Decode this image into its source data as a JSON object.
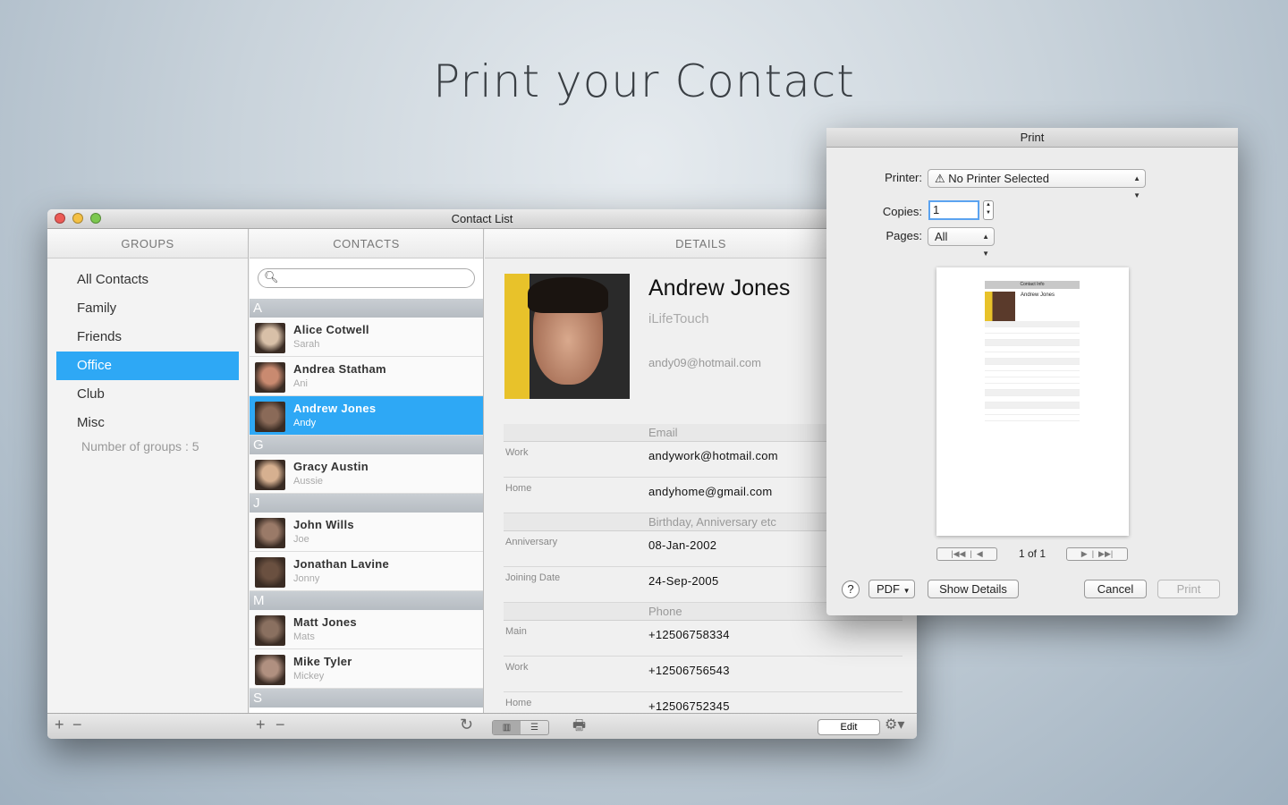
{
  "headline": "Print your Contact",
  "window": {
    "title": "Contact List"
  },
  "groups": {
    "header": "GROUPS",
    "items": [
      "All Contacts",
      "Family",
      "Friends",
      "Office",
      "Club",
      "Misc"
    ],
    "selected": "Office",
    "count_label": "Number of groups : 5"
  },
  "contacts": {
    "header": "CONTACTS",
    "search_placeholder": "",
    "sections": [
      {
        "letter": "A",
        "items": [
          {
            "name": "Alice Cotwell",
            "nick": "Sarah"
          },
          {
            "name": "Andrea  Statham",
            "nick": "Ani"
          },
          {
            "name": "Andrew Jones",
            "nick": "Andy",
            "selected": true
          }
        ]
      },
      {
        "letter": "G",
        "items": [
          {
            "name": "Gracy  Austin",
            "nick": "Aussie"
          }
        ]
      },
      {
        "letter": "J",
        "items": [
          {
            "name": "John  Wills",
            "nick": "Joe"
          },
          {
            "name": "Jonathan  Lavine",
            "nick": "Jonny"
          }
        ]
      },
      {
        "letter": "M",
        "items": [
          {
            "name": "Matt Jones",
            "nick": "Mats"
          },
          {
            "name": "Mike Tyler",
            "nick": "Mickey"
          }
        ]
      },
      {
        "letter": "S",
        "items": []
      }
    ]
  },
  "details": {
    "header": "DETAILS",
    "name": "Andrew Jones",
    "company": "iLifeTouch",
    "email": "andy09@hotmail.com",
    "fields": [
      {
        "section": "Email"
      },
      {
        "label": "Work",
        "value": "andywork@hotmail.com"
      },
      {
        "label": "Home",
        "value": "andyhome@gmail.com"
      },
      {
        "section": "Birthday, Anniversary etc"
      },
      {
        "label": "Anniversary",
        "value": "08-Jan-2002"
      },
      {
        "label": "Joining Date",
        "value": "24-Sep-2005"
      },
      {
        "section": "Phone"
      },
      {
        "label": "Main",
        "value": "+12506758334"
      },
      {
        "label": "Work",
        "value": "+12506756543"
      },
      {
        "label": "Home",
        "value": "+12506752345"
      }
    ],
    "edit_label": "Edit"
  },
  "print": {
    "title": "Print",
    "printer_label": "Printer:",
    "printer_value": "No Printer Selected",
    "copies_label": "Copies:",
    "copies_value": "1",
    "pages_label": "Pages:",
    "pages_value": "All",
    "page_indicator": "1 of 1",
    "help": "?",
    "pdf": "PDF",
    "show_details": "Show Details",
    "cancel": "Cancel",
    "print": "Print",
    "preview": {
      "header": "Contact Info",
      "name": "Andrew Jones"
    }
  }
}
